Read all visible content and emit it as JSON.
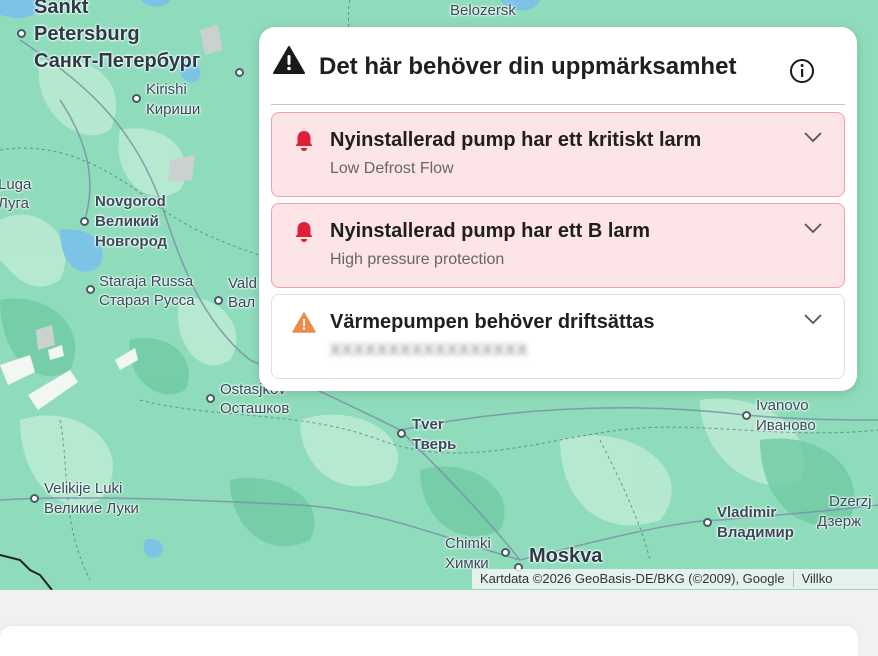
{
  "map": {
    "cities": [
      {
        "id": "sankt-petersburg",
        "lines": [
          "Sankt",
          "Petersburg",
          "Санкт-Петербург"
        ]
      },
      {
        "id": "belozersk",
        "lines": [
          "Belozersk"
        ]
      },
      {
        "id": "kirishi",
        "lines": [
          "Kirishi",
          "Кириши"
        ]
      },
      {
        "id": "luga",
        "lines": [
          "Luga",
          "Луга"
        ]
      },
      {
        "id": "novgorod",
        "lines": [
          "Novgorod",
          "Великий",
          "Новгород"
        ]
      },
      {
        "id": "staraja-russa",
        "lines": [
          "Staraja Russa",
          "Старая Русса"
        ]
      },
      {
        "id": "valdaj",
        "lines": [
          "Vald",
          "Вал"
        ]
      },
      {
        "id": "ostasjkov",
        "lines": [
          "Ostasjkov",
          "Осташков"
        ]
      },
      {
        "id": "tver",
        "lines": [
          "Tver",
          "Тверь"
        ]
      },
      {
        "id": "ivanovo",
        "lines": [
          "Ivanovo",
          "Иваново"
        ]
      },
      {
        "id": "velikije-luki",
        "lines": [
          "Velikije Luki",
          "Великие Луки"
        ]
      },
      {
        "id": "vladimir",
        "lines": [
          "Vladimir",
          "Владимир"
        ]
      },
      {
        "id": "dzerzjinsk",
        "lines": [
          "Dzerzj",
          "Дзерж"
        ]
      },
      {
        "id": "chimki",
        "lines": [
          "Chimki",
          "Химки"
        ]
      },
      {
        "id": "moskva",
        "lines": [
          "Moskva"
        ]
      }
    ],
    "attribution": "Kartdata ©2026 GeoBasis-DE/BKG (©2009), Google",
    "terms_link": "Villko"
  },
  "panel": {
    "title": "Det här behöver din uppmärksamhet",
    "alerts": [
      {
        "title": "Nyinstallerad pump har ett kritiskt larm",
        "subtitle": "Low Defrost Flow",
        "severity": "critical",
        "icon": "bell-icon",
        "color": "#e0203a"
      },
      {
        "title": "Nyinstallerad pump har ett B larm",
        "subtitle": "High pressure protection",
        "severity": "critical",
        "icon": "bell-icon",
        "color": "#e0203a"
      },
      {
        "title": "Värmepumpen behöver driftsättas",
        "subtitle": "XXXXXXXXXXXXXXXXX",
        "severity": "warning",
        "icon": "warning-triangle-icon",
        "color": "#f08a4b"
      }
    ]
  }
}
